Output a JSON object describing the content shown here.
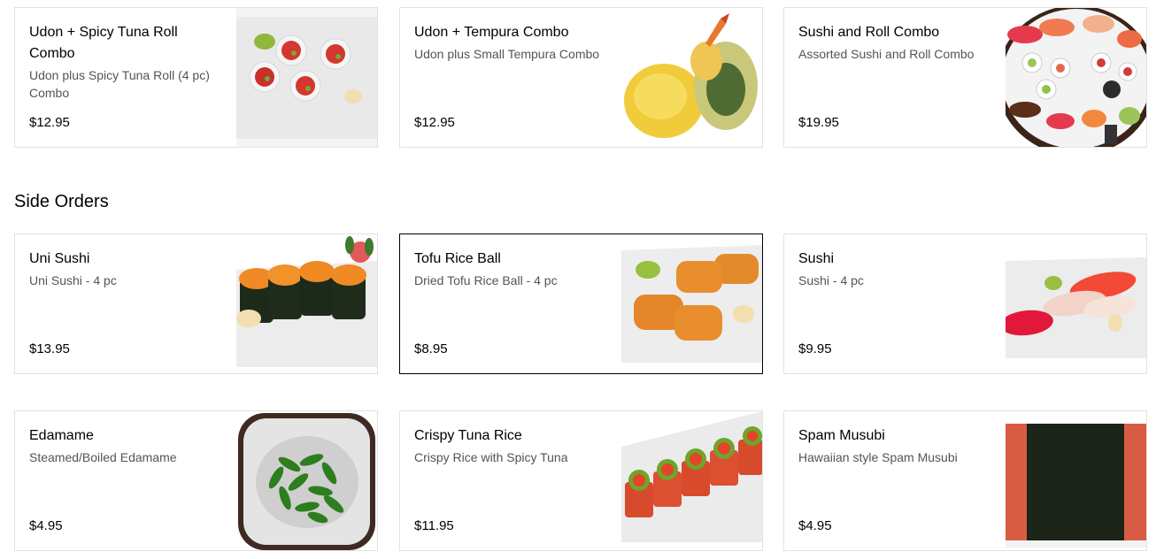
{
  "combos": [
    {
      "name": "Udon + Spicy Tuna Roll Combo",
      "desc": "Udon plus Spicy Tuna Roll (4 pc) Combo",
      "price": "$12.95",
      "image": "spicy-tuna-roll-photo"
    },
    {
      "name": "Udon + Tempura Combo",
      "desc": "Udon plus Small Tempura Combo",
      "price": "$12.95",
      "image": "tempura-photo"
    },
    {
      "name": "Sushi and Roll Combo",
      "desc": "Assorted Sushi and Roll Combo",
      "price": "$19.95",
      "image": "sushi-roll-platter-photo"
    }
  ],
  "side_orders": {
    "title": "Side Orders",
    "items": [
      {
        "name": "Uni Sushi",
        "desc": "Uni Sushi - 4 pc",
        "price": "$13.95",
        "image": "uni-sushi-photo"
      },
      {
        "name": "Tofu Rice Ball",
        "desc": "Dried Tofu Rice Ball - 4 pc",
        "price": "$8.95",
        "image": "inari-photo"
      },
      {
        "name": "Sushi",
        "desc": "Sushi - 4 pc",
        "price": "$9.95",
        "image": "nigiri-photo"
      },
      {
        "name": "Edamame",
        "desc": "Steamed/Boiled Edamame",
        "price": "$4.95",
        "image": "edamame-photo"
      },
      {
        "name": "Crispy Tuna Rice",
        "desc": "Crispy Rice with Spicy Tuna",
        "price": "$11.95",
        "image": "crispy-tuna-rice-photo"
      },
      {
        "name": "Spam Musubi",
        "desc": "Hawaiian style Spam Musubi",
        "price": "$4.95",
        "image": "spam-musubi-photo"
      }
    ]
  },
  "colors": {
    "border": "#e2e2e2",
    "selected_border": "#000000",
    "secondary_text": "#545454"
  }
}
